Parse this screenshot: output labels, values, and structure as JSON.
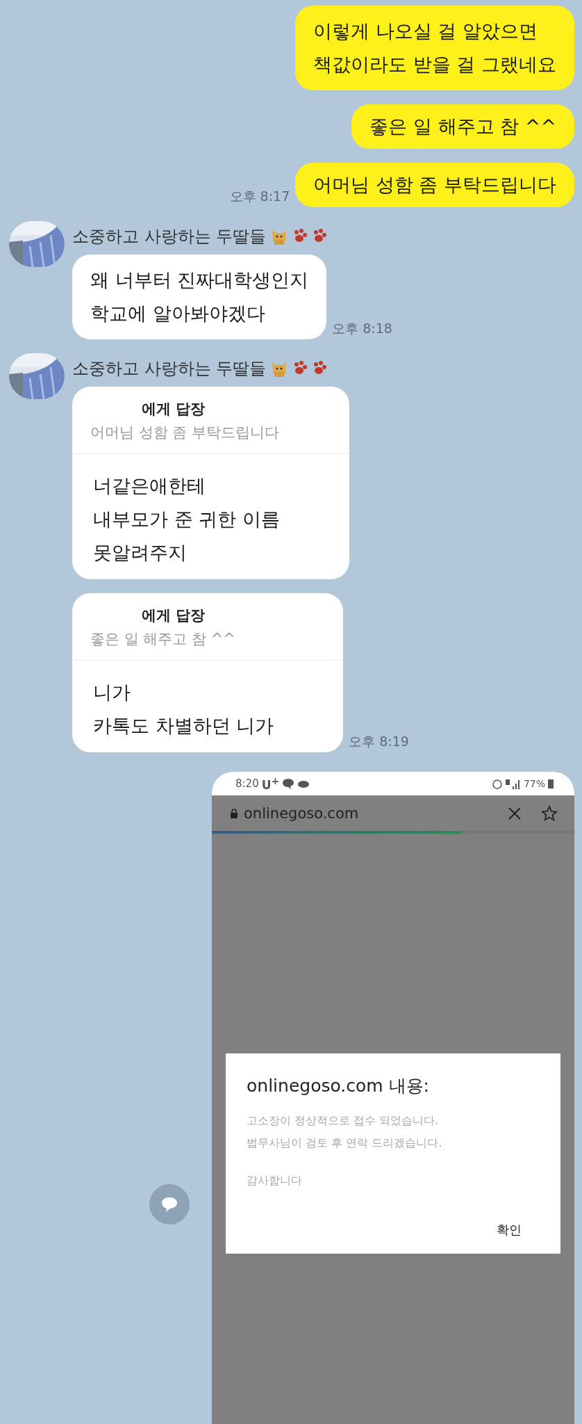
{
  "chat": [
    {
      "kind": "sent",
      "lines": [
        "이렇게 나오실 걸 알았으면",
        "책값이라도 받을 걸 그랬네요"
      ]
    },
    {
      "kind": "sent",
      "lines": [
        "좋은 일 해주고 참 ^^"
      ]
    },
    {
      "kind": "sent",
      "lines": [
        "어머님 성함 좀 부탁드립니다"
      ],
      "time": "오후 8:17"
    },
    {
      "kind": "received",
      "sender": "소중하고 사랑하는 두딸들",
      "lines": [
        "왜 너부터 진짜대학생인지",
        "학교에 알아봐야겠다"
      ],
      "time": "오후 8:18"
    },
    {
      "kind": "reply",
      "sender": "소중하고 사랑하는 두딸들",
      "reply_header": "에게 답장",
      "quote": "어머님 성함 좀 부탁드립니다",
      "lines": [
        "너같은애한테",
        "내부모가 준 귀한 이름",
        "못알려주지"
      ]
    },
    {
      "kind": "reply",
      "reply_header": "에게 답장",
      "quote": "좋은 일 해주고 참 ^^",
      "lines": [
        "니가",
        "카톡도 차별하던 니가"
      ],
      "time": "오후 8:19"
    },
    {
      "kind": "screenshot",
      "status_time": "8:20",
      "carrier": "U$^{+}$",
      "battery": "77%",
      "url": "onlinegoso.com",
      "level": 0.69,
      "dialog": {
        "title": "onlinegoso.com 내용:",
        "lines": [
          "고소장이 정상적으로 접수 되었습니다.",
          "법무사님이 검토 후 연락 드리겠습니다."
        ],
        "closing": "감사합니다",
        "button": "확인"
      }
    }
  ]
}
